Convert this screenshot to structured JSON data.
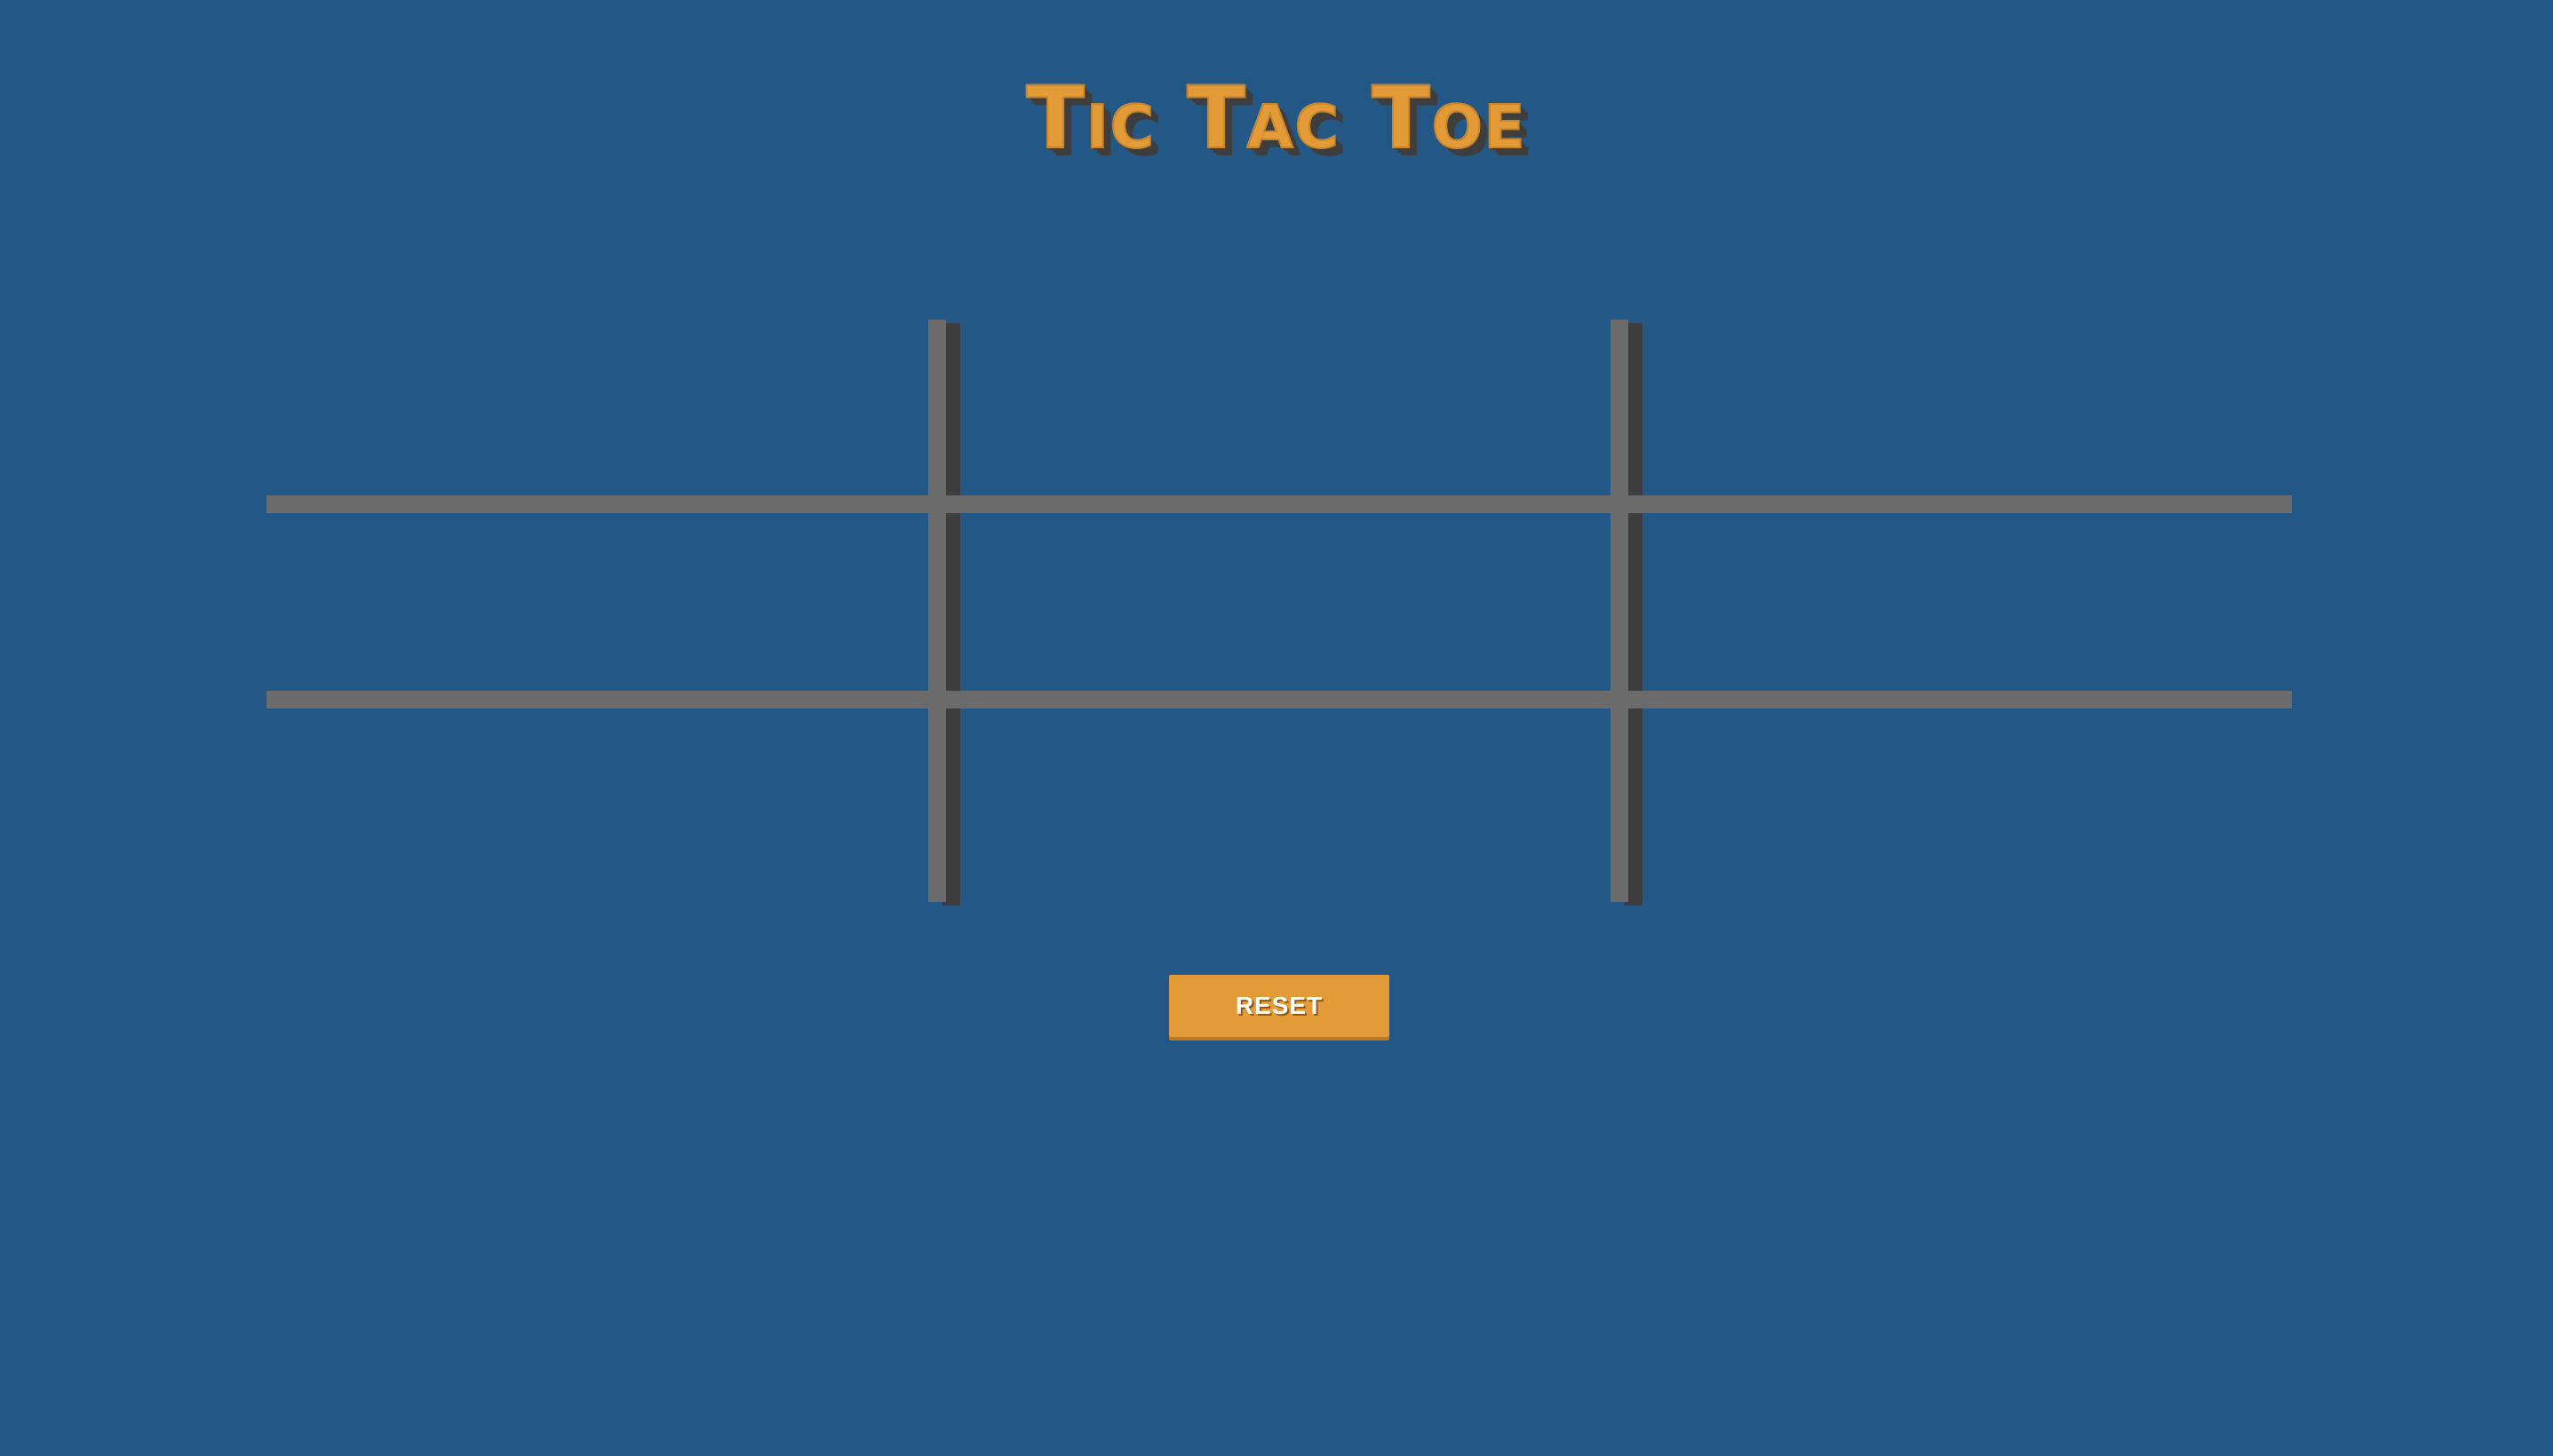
{
  "title": "Tic Tac Toe",
  "board": {
    "cells": [
      "",
      "",
      "",
      "",
      "",
      "",
      "",
      "",
      ""
    ]
  },
  "reset_label": "RESET",
  "colors": {
    "background": "#235886",
    "accent": "#e39b38",
    "grid_line": "#6b6b6b",
    "grid_shadow": "#3d3d3d"
  }
}
